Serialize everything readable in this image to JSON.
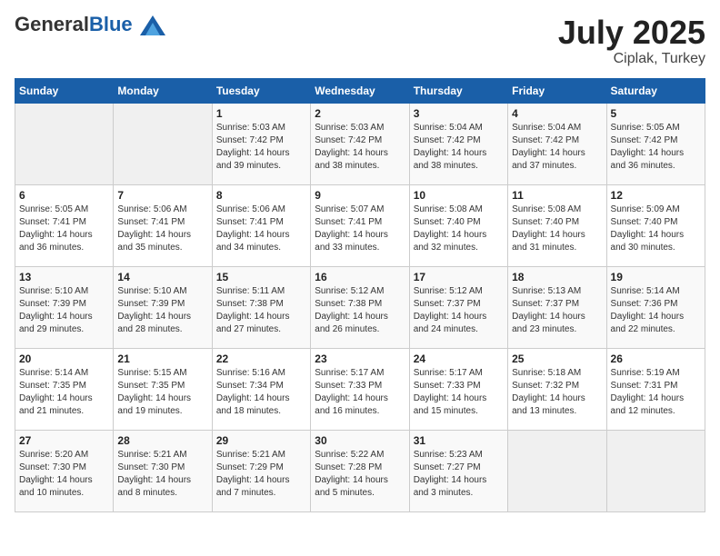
{
  "header": {
    "logo_general": "General",
    "logo_blue": "Blue",
    "month": "July 2025",
    "location": "Ciplak, Turkey"
  },
  "days_of_week": [
    "Sunday",
    "Monday",
    "Tuesday",
    "Wednesday",
    "Thursday",
    "Friday",
    "Saturday"
  ],
  "weeks": [
    [
      {
        "day": "",
        "empty": true
      },
      {
        "day": "",
        "empty": true
      },
      {
        "day": "1",
        "sunrise": "Sunrise: 5:03 AM",
        "sunset": "Sunset: 7:42 PM",
        "daylight": "Daylight: 14 hours and 39 minutes."
      },
      {
        "day": "2",
        "sunrise": "Sunrise: 5:03 AM",
        "sunset": "Sunset: 7:42 PM",
        "daylight": "Daylight: 14 hours and 38 minutes."
      },
      {
        "day": "3",
        "sunrise": "Sunrise: 5:04 AM",
        "sunset": "Sunset: 7:42 PM",
        "daylight": "Daylight: 14 hours and 38 minutes."
      },
      {
        "day": "4",
        "sunrise": "Sunrise: 5:04 AM",
        "sunset": "Sunset: 7:42 PM",
        "daylight": "Daylight: 14 hours and 37 minutes."
      },
      {
        "day": "5",
        "sunrise": "Sunrise: 5:05 AM",
        "sunset": "Sunset: 7:42 PM",
        "daylight": "Daylight: 14 hours and 36 minutes."
      }
    ],
    [
      {
        "day": "6",
        "sunrise": "Sunrise: 5:05 AM",
        "sunset": "Sunset: 7:41 PM",
        "daylight": "Daylight: 14 hours and 36 minutes."
      },
      {
        "day": "7",
        "sunrise": "Sunrise: 5:06 AM",
        "sunset": "Sunset: 7:41 PM",
        "daylight": "Daylight: 14 hours and 35 minutes."
      },
      {
        "day": "8",
        "sunrise": "Sunrise: 5:06 AM",
        "sunset": "Sunset: 7:41 PM",
        "daylight": "Daylight: 14 hours and 34 minutes."
      },
      {
        "day": "9",
        "sunrise": "Sunrise: 5:07 AM",
        "sunset": "Sunset: 7:41 PM",
        "daylight": "Daylight: 14 hours and 33 minutes."
      },
      {
        "day": "10",
        "sunrise": "Sunrise: 5:08 AM",
        "sunset": "Sunset: 7:40 PM",
        "daylight": "Daylight: 14 hours and 32 minutes."
      },
      {
        "day": "11",
        "sunrise": "Sunrise: 5:08 AM",
        "sunset": "Sunset: 7:40 PM",
        "daylight": "Daylight: 14 hours and 31 minutes."
      },
      {
        "day": "12",
        "sunrise": "Sunrise: 5:09 AM",
        "sunset": "Sunset: 7:40 PM",
        "daylight": "Daylight: 14 hours and 30 minutes."
      }
    ],
    [
      {
        "day": "13",
        "sunrise": "Sunrise: 5:10 AM",
        "sunset": "Sunset: 7:39 PM",
        "daylight": "Daylight: 14 hours and 29 minutes."
      },
      {
        "day": "14",
        "sunrise": "Sunrise: 5:10 AM",
        "sunset": "Sunset: 7:39 PM",
        "daylight": "Daylight: 14 hours and 28 minutes."
      },
      {
        "day": "15",
        "sunrise": "Sunrise: 5:11 AM",
        "sunset": "Sunset: 7:38 PM",
        "daylight": "Daylight: 14 hours and 27 minutes."
      },
      {
        "day": "16",
        "sunrise": "Sunrise: 5:12 AM",
        "sunset": "Sunset: 7:38 PM",
        "daylight": "Daylight: 14 hours and 26 minutes."
      },
      {
        "day": "17",
        "sunrise": "Sunrise: 5:12 AM",
        "sunset": "Sunset: 7:37 PM",
        "daylight": "Daylight: 14 hours and 24 minutes."
      },
      {
        "day": "18",
        "sunrise": "Sunrise: 5:13 AM",
        "sunset": "Sunset: 7:37 PM",
        "daylight": "Daylight: 14 hours and 23 minutes."
      },
      {
        "day": "19",
        "sunrise": "Sunrise: 5:14 AM",
        "sunset": "Sunset: 7:36 PM",
        "daylight": "Daylight: 14 hours and 22 minutes."
      }
    ],
    [
      {
        "day": "20",
        "sunrise": "Sunrise: 5:14 AM",
        "sunset": "Sunset: 7:35 PM",
        "daylight": "Daylight: 14 hours and 21 minutes."
      },
      {
        "day": "21",
        "sunrise": "Sunrise: 5:15 AM",
        "sunset": "Sunset: 7:35 PM",
        "daylight": "Daylight: 14 hours and 19 minutes."
      },
      {
        "day": "22",
        "sunrise": "Sunrise: 5:16 AM",
        "sunset": "Sunset: 7:34 PM",
        "daylight": "Daylight: 14 hours and 18 minutes."
      },
      {
        "day": "23",
        "sunrise": "Sunrise: 5:17 AM",
        "sunset": "Sunset: 7:33 PM",
        "daylight": "Daylight: 14 hours and 16 minutes."
      },
      {
        "day": "24",
        "sunrise": "Sunrise: 5:17 AM",
        "sunset": "Sunset: 7:33 PM",
        "daylight": "Daylight: 14 hours and 15 minutes."
      },
      {
        "day": "25",
        "sunrise": "Sunrise: 5:18 AM",
        "sunset": "Sunset: 7:32 PM",
        "daylight": "Daylight: 14 hours and 13 minutes."
      },
      {
        "day": "26",
        "sunrise": "Sunrise: 5:19 AM",
        "sunset": "Sunset: 7:31 PM",
        "daylight": "Daylight: 14 hours and 12 minutes."
      }
    ],
    [
      {
        "day": "27",
        "sunrise": "Sunrise: 5:20 AM",
        "sunset": "Sunset: 7:30 PM",
        "daylight": "Daylight: 14 hours and 10 minutes."
      },
      {
        "day": "28",
        "sunrise": "Sunrise: 5:21 AM",
        "sunset": "Sunset: 7:30 PM",
        "daylight": "Daylight: 14 hours and 8 minutes."
      },
      {
        "day": "29",
        "sunrise": "Sunrise: 5:21 AM",
        "sunset": "Sunset: 7:29 PM",
        "daylight": "Daylight: 14 hours and 7 minutes."
      },
      {
        "day": "30",
        "sunrise": "Sunrise: 5:22 AM",
        "sunset": "Sunset: 7:28 PM",
        "daylight": "Daylight: 14 hours and 5 minutes."
      },
      {
        "day": "31",
        "sunrise": "Sunrise: 5:23 AM",
        "sunset": "Sunset: 7:27 PM",
        "daylight": "Daylight: 14 hours and 3 minutes."
      },
      {
        "day": "",
        "empty": true
      },
      {
        "day": "",
        "empty": true
      }
    ]
  ]
}
